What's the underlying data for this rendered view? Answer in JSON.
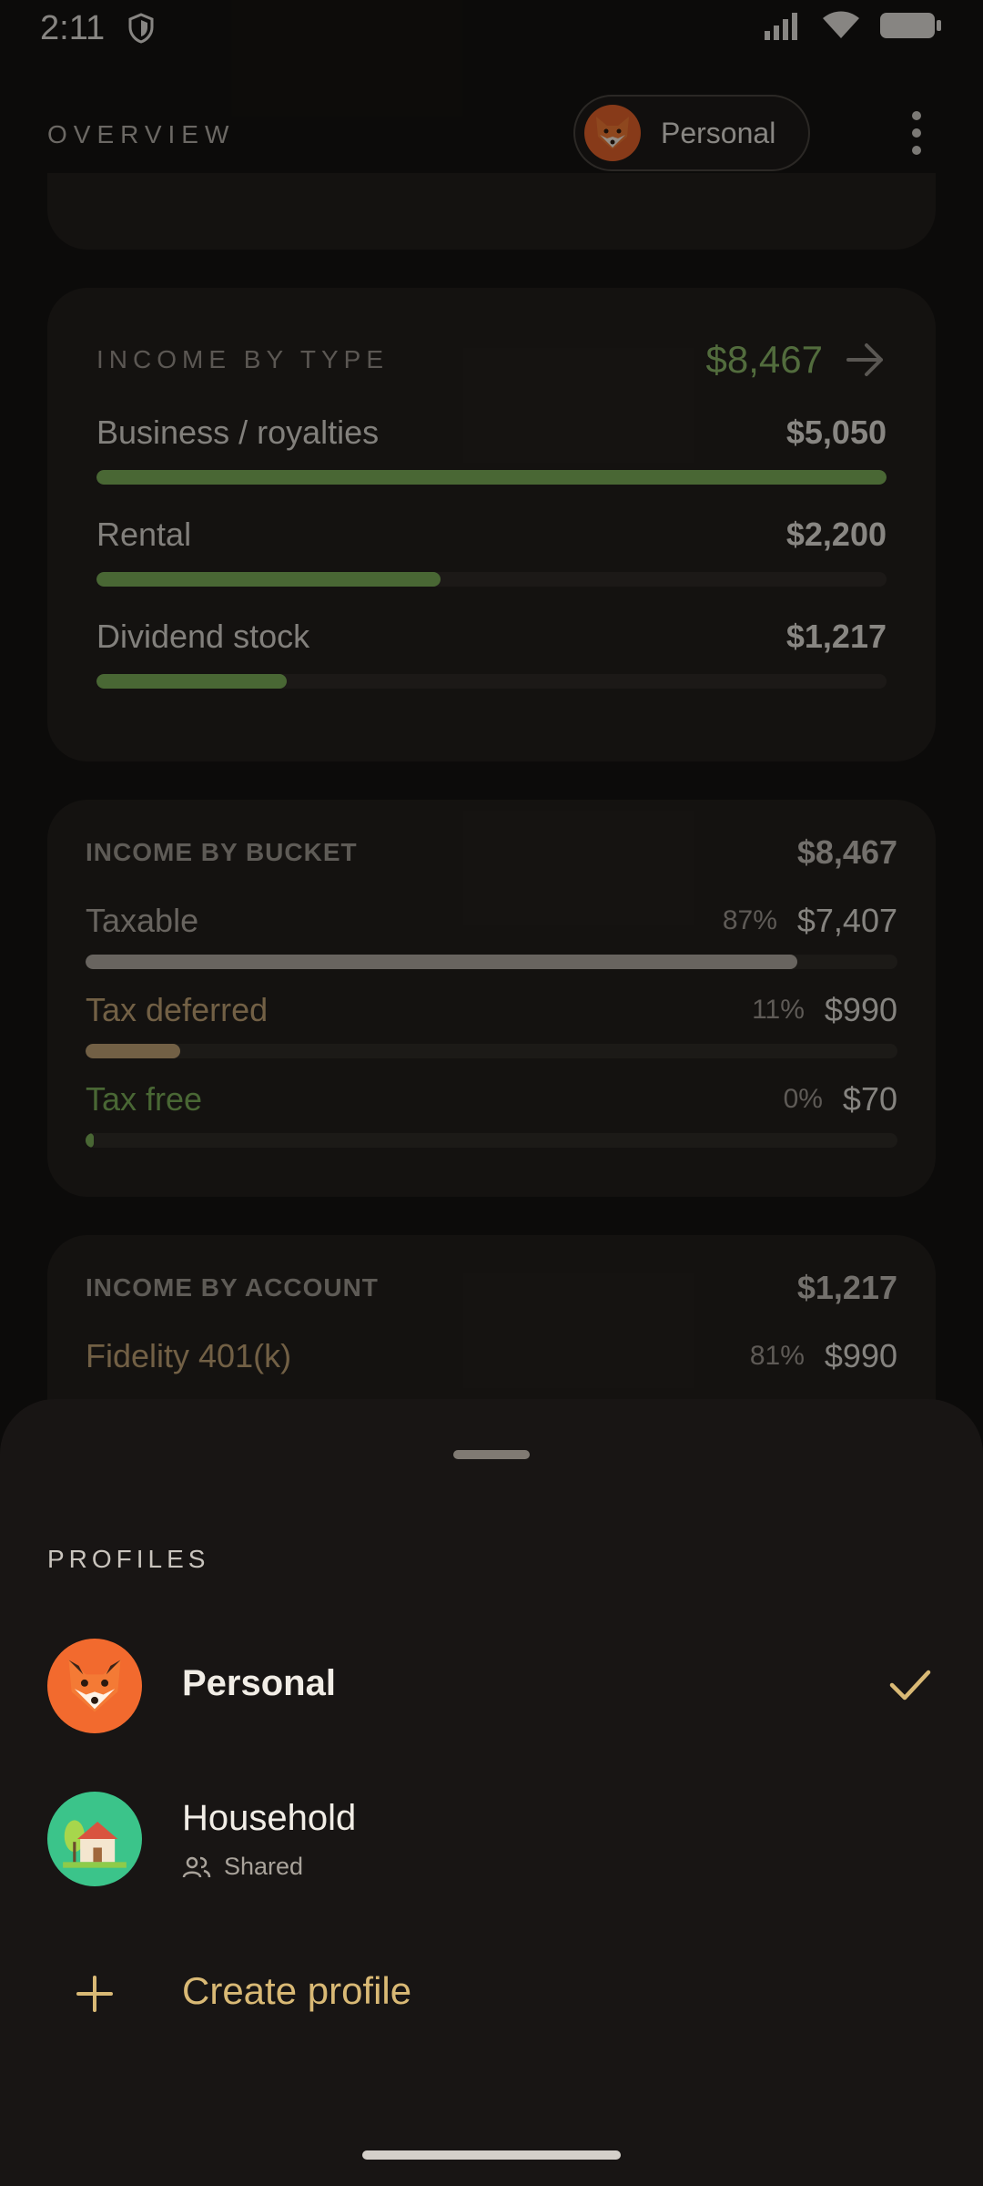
{
  "status_bar": {
    "time": "2:11"
  },
  "header": {
    "title": "OVERVIEW",
    "profile_chip_label": "Personal"
  },
  "income_by_type": {
    "title": "INCOME BY TYPE",
    "total": "$8,467",
    "rows": [
      {
        "label": "Business / royalties",
        "value": "$5,050",
        "fraction": 1.0
      },
      {
        "label": "Rental",
        "value": "$2,200",
        "fraction": 0.436
      },
      {
        "label": "Dividend stock",
        "value": "$1,217",
        "fraction": 0.241
      }
    ]
  },
  "income_by_bucket": {
    "title": "INCOME BY BUCKET",
    "total": "$8,467",
    "rows": [
      {
        "label": "Taxable",
        "pct": "87%",
        "value": "$7,407",
        "fraction": 0.877,
        "color": "#b3ada4"
      },
      {
        "label": "Tax deferred",
        "pct": "11%",
        "value": "$990",
        "fraction": 0.117,
        "color": "#c4a678"
      },
      {
        "label": "Tax free",
        "pct": "0%",
        "value": "$70",
        "fraction": 0.008,
        "color": "#7fb25b"
      }
    ]
  },
  "income_by_account": {
    "title": "INCOME BY ACCOUNT",
    "total": "$1,217",
    "rows": [
      {
        "label": "Fidelity 401(k)",
        "pct": "81%",
        "value": "$990",
        "color": "#c4a678"
      }
    ]
  },
  "profiles_sheet": {
    "title": "PROFILES",
    "profiles": [
      {
        "name": "Personal",
        "selected": true,
        "avatar_icon": "fox-icon",
        "avatar_color": "#f26a2e"
      },
      {
        "name": "Household",
        "sub_label": "Shared",
        "selected": false,
        "avatar_icon": "house-icon",
        "avatar_color": "#3bc48a"
      }
    ],
    "create_label": "Create profile"
  },
  "colors": {
    "accent_green": "#8dbb6a",
    "accent_gold": "#d9b975",
    "bar_green": "#7fb25b"
  }
}
